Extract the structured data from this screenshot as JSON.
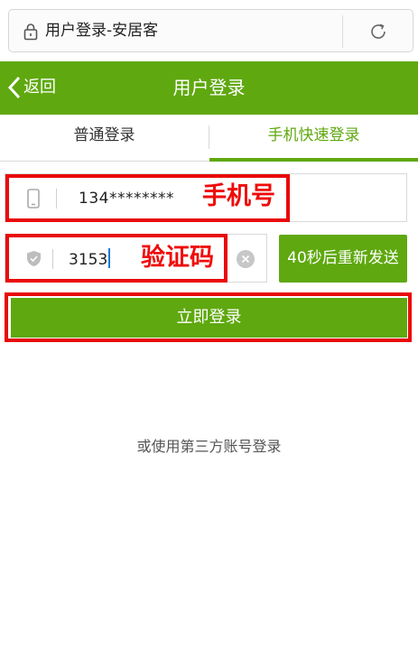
{
  "browser": {
    "tab_title": "用户登录-安居客",
    "icons": {
      "lock": "lock-icon",
      "reload": "reload-icon"
    }
  },
  "header": {
    "back_label": "返回",
    "title": "用户登录",
    "bg_color": "#5fa80f"
  },
  "tabs": [
    {
      "label": "普通登录",
      "active": false
    },
    {
      "label": "手机快速登录",
      "active": true
    }
  ],
  "form": {
    "phone": {
      "value": "134********",
      "annotation": "手机号",
      "icon": "phone-icon"
    },
    "code": {
      "value": "3153",
      "annotation": "验证码",
      "icon": "shield-icon",
      "clear_icon": "clear-icon"
    },
    "resend_label": "40秒后重新发送",
    "login_label": "立即登录"
  },
  "third_party_label": "或使用第三方账号登录",
  "colors": {
    "accent": "#5fa80f",
    "annotation_red": "#e80a0a"
  }
}
